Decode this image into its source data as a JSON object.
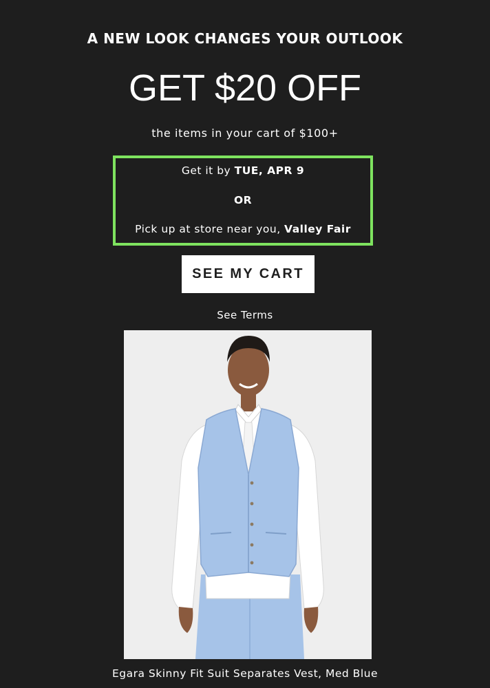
{
  "promo": {
    "tagline": "A NEW LOOK CHANGES YOUR OUTLOOK",
    "headline": "GET $20 OFF",
    "subline": "the items in your cart of $100+"
  },
  "delivery": {
    "date_prefix": "Get it by ",
    "date_value": "TUE, APR 9",
    "or_label": "OR",
    "store_prefix": "Pick up at store near you, ",
    "store_name": "Valley Fair",
    "border_color": "#7ee35f"
  },
  "cta": {
    "label": "SEE MY CART"
  },
  "terms": {
    "label": "See Terms"
  },
  "product": {
    "image_icon": "product-photo",
    "name": "Egara Skinny Fit Suit Separates Vest, Med Blue",
    "vest_color": "#a6c3e8"
  },
  "colors": {
    "background": "#1e1e1e",
    "text": "#ffffff",
    "button_bg": "#ffffff",
    "button_text": "#1e1e1e"
  }
}
